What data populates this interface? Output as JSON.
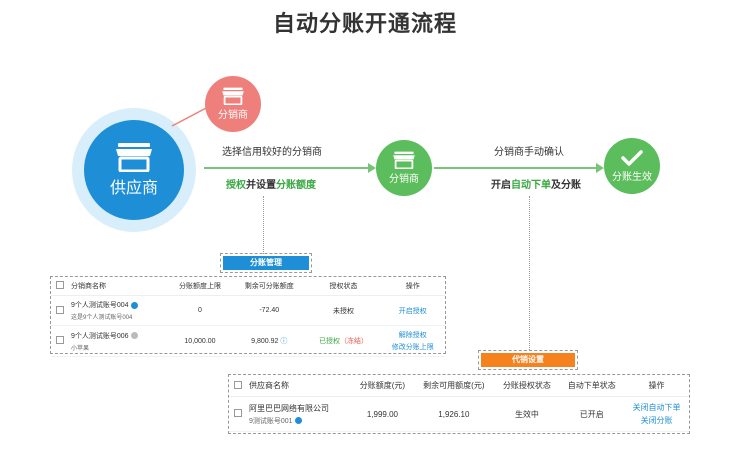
{
  "title": "自动分账开通流程",
  "nodes": {
    "supplier": "供应商",
    "distributor_red": "分销商",
    "distributor_green": "分销商",
    "done": "分账生效"
  },
  "flow": {
    "step1_top": "选择信用较好的分销商",
    "step1_bottom_a": "授权",
    "step1_bottom_b": "并设置",
    "step1_bottom_c": "分账额度",
    "step2_top": "分销商手动确认",
    "step2_bottom_a": "开启",
    "step2_bottom_b": "自动下单",
    "step2_bottom_c": "及分账"
  },
  "colors": {
    "blue": "#1e8fd6",
    "green": "#5bbd5b",
    "red": "#ee7f7b",
    "orange": "#f5821f"
  },
  "panel1": {
    "tag": "分账管理",
    "headers": [
      "分销商名称",
      "分账额度上限",
      "剩余可分账额度",
      "授权状态",
      "操作"
    ],
    "rows": [
      {
        "name": "9个人测试账号004",
        "sub": "这是9个人测试账号004",
        "limit": "0",
        "remaining": "-72.40",
        "status": "未授权",
        "action1": "开启授权",
        "action2": ""
      },
      {
        "name": "9个人测试账号006",
        "sub": "小苹果",
        "limit": "10,000.00",
        "remaining": "9,800.92",
        "status_a": "已授权",
        "status_b": "（冻结）",
        "action1": "解除授权",
        "action2": "修改分账上限"
      }
    ]
  },
  "panel2": {
    "tag": "代销设置",
    "headers": [
      "供应商名称",
      "分账额度(元)",
      "剩余可用额度(元)",
      "分账授权状态",
      "自动下单状态",
      "操作"
    ],
    "row": {
      "name": "阿里巴巴网络有限公司",
      "sub": "9测试账号001",
      "limit": "1,999.00",
      "remaining": "1,926.10",
      "auth": "生效中",
      "auto": "已开启",
      "action1": "关闭自动下单",
      "action2": "关闭分账"
    }
  }
}
